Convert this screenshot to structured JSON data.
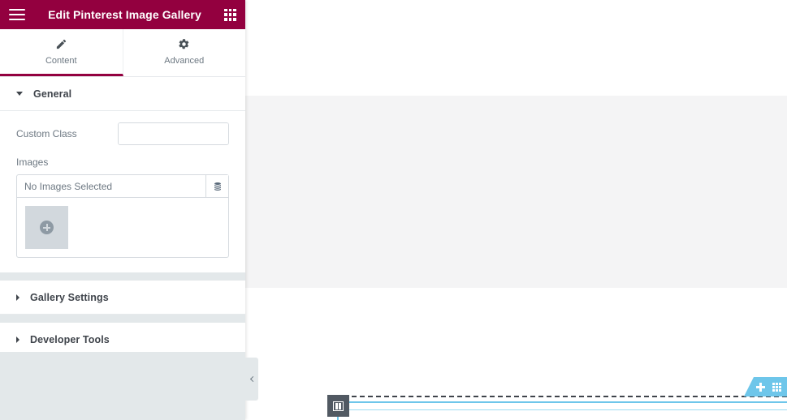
{
  "panel": {
    "header": {
      "title": "Edit Pinterest Image Gallery",
      "menu_icon": "hamburger-menu-icon",
      "apps_icon": "apps-grid-icon"
    },
    "tabs": [
      {
        "label": "Content",
        "icon": "pencil-icon",
        "active": true
      },
      {
        "label": "Advanced",
        "icon": "gear-icon",
        "active": false
      }
    ],
    "sections": [
      {
        "id": "general",
        "title": "General",
        "expanded": true
      },
      {
        "id": "gallery-settings",
        "title": "Gallery Settings",
        "expanded": false
      },
      {
        "id": "developer-tools",
        "title": "Developer Tools",
        "expanded": false
      }
    ],
    "general": {
      "custom_class": {
        "label": "Custom Class",
        "value": "",
        "placeholder": "",
        "dynamic_icon": "dynamic-tags-icon"
      },
      "images": {
        "label": "Images",
        "status": "No Images Selected",
        "dynamic_icon": "dynamic-tags-icon",
        "add_icon": "plus-circle-icon"
      }
    },
    "collapse_tab": {
      "icon": "chevron-left-icon"
    }
  },
  "canvas": {
    "section_toolbar": {
      "add_icon": "plus-icon",
      "grid_icon": "grid-handle-icon"
    },
    "column_handle": {
      "icon": "columns-icon"
    }
  },
  "colors": {
    "brand": "#93003f",
    "accent_blue": "#6ec6ea",
    "panel_gray": "#e3e8ea",
    "canvas_block": "#f4f4f5",
    "handle_dark": "#515962"
  }
}
